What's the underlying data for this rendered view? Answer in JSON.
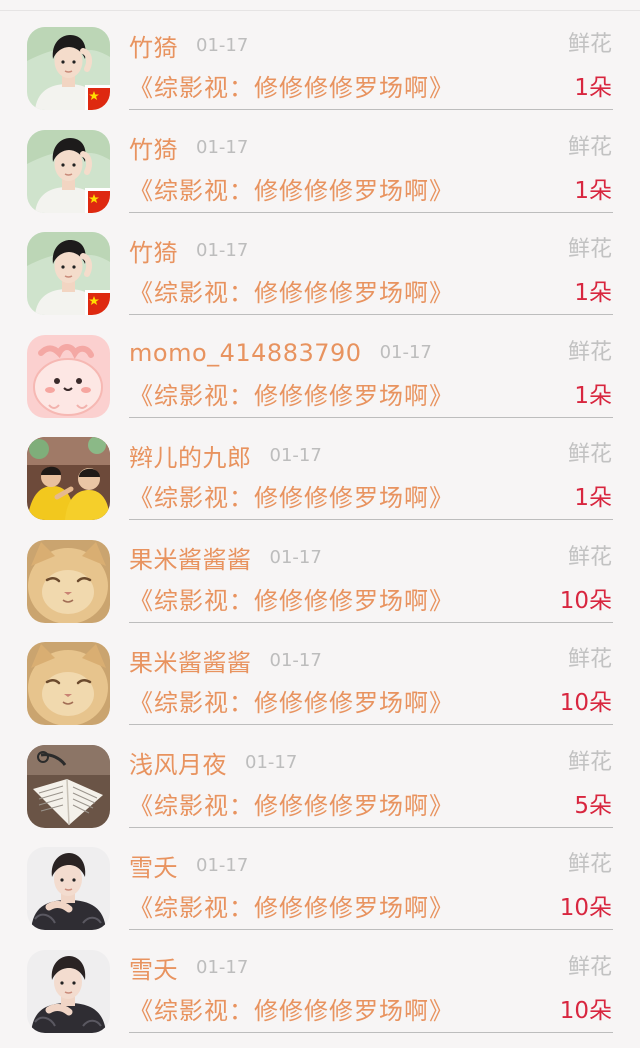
{
  "records": [
    {
      "user": "竹猗",
      "date": "01-17",
      "gift_type": "鲜花",
      "book": "《综影视：修修修修罗场啊》",
      "amount": "1朵",
      "avatar": "man-green-flag"
    },
    {
      "user": "竹猗",
      "date": "01-17",
      "gift_type": "鲜花",
      "book": "《综影视：修修修修罗场啊》",
      "amount": "1朵",
      "avatar": "man-green-flag"
    },
    {
      "user": "竹猗",
      "date": "01-17",
      "gift_type": "鲜花",
      "book": "《综影视：修修修修罗场啊》",
      "amount": "1朵",
      "avatar": "man-green-flag"
    },
    {
      "user": "momo_414883790",
      "date": "01-17",
      "gift_type": "鲜花",
      "book": "《综影视：修修修修罗场啊》",
      "amount": "1朵",
      "avatar": "pink-cartoon"
    },
    {
      "user": "辫儿的九郎",
      "date": "01-17",
      "gift_type": "鲜花",
      "book": "《综影视：修修修修罗场啊》",
      "amount": "1朵",
      "avatar": "performers-yellow"
    },
    {
      "user": "果米酱酱酱",
      "date": "01-17",
      "gift_type": "鲜花",
      "book": "《综影视：修修修修罗场啊》",
      "amount": "10朵",
      "avatar": "kitten"
    },
    {
      "user": "果米酱酱酱",
      "date": "01-17",
      "gift_type": "鲜花",
      "book": "《综影视：修修修修罗场啊》",
      "amount": "10朵",
      "avatar": "kitten"
    },
    {
      "user": "浅风月夜",
      "date": "01-17",
      "gift_type": "鲜花",
      "book": "《综影视：修修修修罗场啊》",
      "amount": "5朵",
      "avatar": "open-book"
    },
    {
      "user": "雪夭",
      "date": "01-17",
      "gift_type": "鲜花",
      "book": "《综影视：修修修修罗场啊》",
      "amount": "10朵",
      "avatar": "man-dark-jacket"
    },
    {
      "user": "雪夭",
      "date": "01-17",
      "gift_type": "鲜花",
      "book": "《综影视：修修修修罗场啊》",
      "amount": "10朵",
      "avatar": "man-dark-jacket"
    }
  ],
  "colors": {
    "name": "#e8935f",
    "book": "#e8935f",
    "amount": "#d8263f",
    "meta": "#bdbdbd",
    "background": "#f7f5f5"
  }
}
